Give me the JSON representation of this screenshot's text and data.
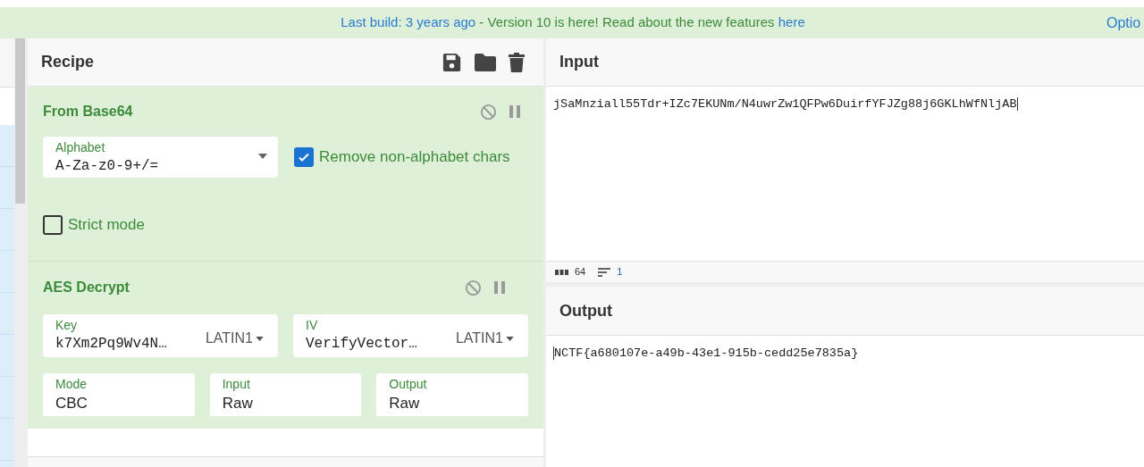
{
  "banner": {
    "build_link": "Last build: 3 years ago",
    "message": " - Version 10 is here! Read about the new features ",
    "here_link": "here",
    "options_link": "Optio"
  },
  "recipe": {
    "title": "Recipe",
    "operations": [
      {
        "name": "From Base64",
        "args": [
          {
            "kind": "select",
            "label": "Alphabet",
            "value": "A-Za-z0-9+/="
          },
          {
            "kind": "checkbox",
            "label": "Remove non-alphabet chars",
            "checked": true
          },
          {
            "kind": "checkbox",
            "label": "Strict mode",
            "checked": false
          }
        ]
      },
      {
        "name": "AES Decrypt",
        "args": [
          {
            "kind": "toggle_string",
            "label": "Key",
            "value": "k7Xm2Pq9Wv4N…",
            "encoding": "LATIN1"
          },
          {
            "kind": "toggle_string",
            "label": "IV",
            "value": "VerifyVector…",
            "encoding": "LATIN1"
          },
          {
            "kind": "option",
            "label": "Mode",
            "value": "CBC"
          },
          {
            "kind": "option",
            "label": "Input",
            "value": "Raw"
          },
          {
            "kind": "option",
            "label": "Output",
            "value": "Raw"
          }
        ]
      }
    ]
  },
  "input": {
    "title": "Input",
    "text": "jSaMnziall55Tdr+IZc7EKUNm/N4uwrZw1QFPw6DuirfYFJZg88j6GKLhWfNljAB",
    "stats": [
      {
        "kind": "length",
        "value": "64"
      },
      {
        "kind": "lines",
        "value": "1"
      }
    ]
  },
  "output": {
    "title": "Output",
    "text": "NCTF{a680107e-a49b-43e1-915b-cedd25e7835a}"
  }
}
